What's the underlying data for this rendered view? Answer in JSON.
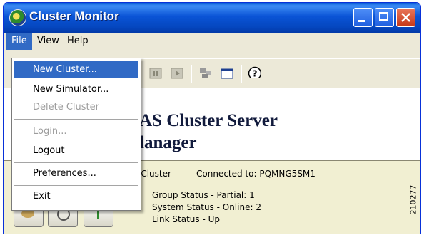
{
  "window": {
    "title": "Cluster Monitor",
    "controls": [
      "minimize",
      "maximize",
      "close"
    ]
  },
  "menubar": {
    "items": [
      {
        "label": "File",
        "active": true
      },
      {
        "label": "View",
        "active": false
      },
      {
        "label": "Help",
        "active": false
      }
    ]
  },
  "file_menu": {
    "items": [
      {
        "label": "New Cluster...",
        "state": "highlighted"
      },
      {
        "label": "New Simulator...",
        "state": "enabled"
      },
      {
        "label": "Delete Cluster",
        "state": "disabled"
      },
      {
        "label": "Login...",
        "state": "disabled"
      },
      {
        "label": "Logout",
        "state": "enabled"
      },
      {
        "label": "Preferences...",
        "state": "enabled"
      },
      {
        "label": "Exit",
        "state": "enabled"
      }
    ]
  },
  "toolbar": {
    "icons": [
      "pause-icon",
      "play-icon",
      "cluster-icon",
      "window-icon",
      "help-icon"
    ]
  },
  "main": {
    "heading_line1": "AS  Cluster Server",
    "heading_line2": "lanager"
  },
  "status": {
    "cluster_label": "-Cluster",
    "connected_text": "Connected to: PQMNG5SM1",
    "group_status": "Group Status   - Partial: 1",
    "system_status": "System Status - Online: 2",
    "link_status": "Link Status      - Up"
  },
  "figure_id": "210277",
  "colors": {
    "titlebar": "#0a54d6",
    "menu_highlight": "#316ac5",
    "window_bg": "#ece9d8",
    "status_bg": "#f1efd2",
    "close_button": "#c4391a"
  }
}
